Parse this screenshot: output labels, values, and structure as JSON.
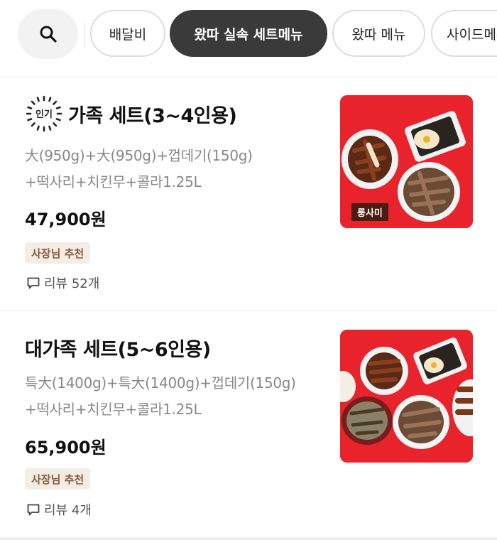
{
  "tabs": {
    "search_icon": "search-icon",
    "items": [
      {
        "label": "배달비",
        "active": false
      },
      {
        "label": "왔따 실속 세트메뉴",
        "active": true
      },
      {
        "label": "왔따 메뉴",
        "active": false
      },
      {
        "label": "사이드메뉴",
        "active": false
      }
    ]
  },
  "menu": [
    {
      "badge": "인기",
      "title": "가족 세트(3~4인용)",
      "desc_line1": "大(950g)+大(950g)+껍데기(150g)",
      "desc_line2": "+떡사리+치킨무+콜라1.25L",
      "price": "47,900원",
      "owner_badge": "사장님 추천",
      "review": "리뷰 52개",
      "photo_label": "룽사미"
    },
    {
      "title": "대가족 세트(5~6인용)",
      "desc_line1": "특大(1400g)+특大(1400g)+껍데기(150g)",
      "desc_line2": "+떡사리+치킨무+콜라1.25L",
      "price": "65,900원",
      "owner_badge": "사장님 추천",
      "review": "리뷰 4개"
    }
  ],
  "colors": {
    "active_tab_bg": "#3a3a3a",
    "photo_bg": "#e8232b",
    "owner_badge_bg": "#f4ede6",
    "owner_badge_text": "#8a5a3a"
  }
}
